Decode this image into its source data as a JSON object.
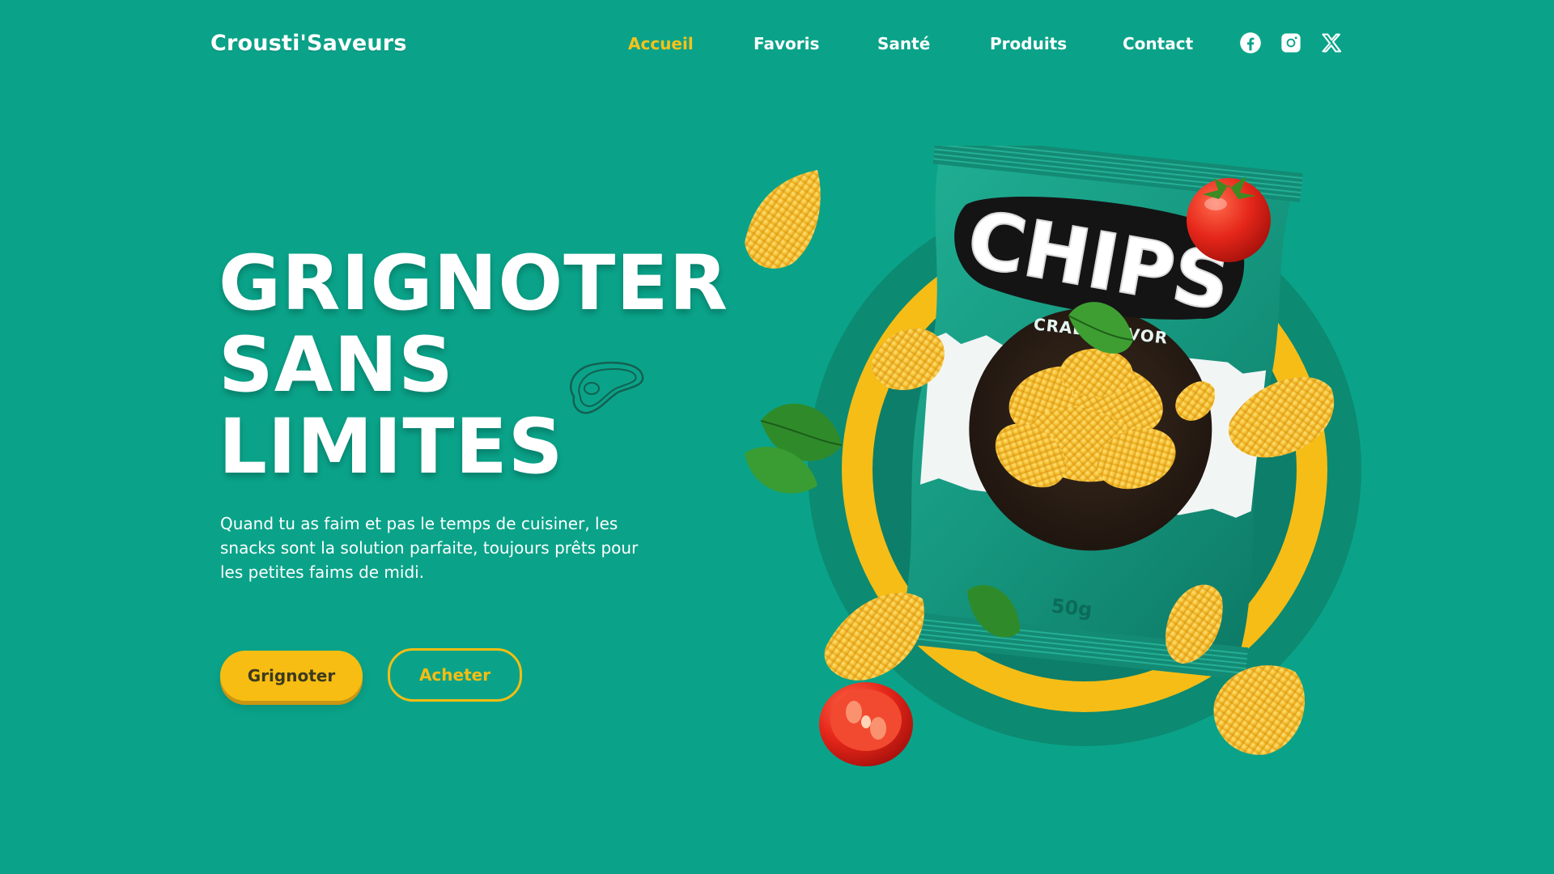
{
  "brand": {
    "logo_text": "Crousti'Saveurs"
  },
  "nav": {
    "items": [
      {
        "label": "Accueil",
        "active": true
      },
      {
        "label": "Favoris",
        "active": false
      },
      {
        "label": "Santé",
        "active": false
      },
      {
        "label": "Produits",
        "active": false
      },
      {
        "label": "Contact",
        "active": false
      }
    ]
  },
  "socials": [
    {
      "icon": "facebook-icon"
    },
    {
      "icon": "instagram-icon"
    },
    {
      "icon": "x-twitter-icon"
    }
  ],
  "hero": {
    "headline_lines": [
      "GRIGNOTER",
      "SANS",
      "LIMITES"
    ],
    "subtitle": "Quand tu as faim et pas le temps de cuisiner, les snacks sont la solution parfaite, toujours prêts pour les petites faims de midi.",
    "primary_button": "Grignoter",
    "secondary_button": "Acheter"
  },
  "product": {
    "brand_text": "CHIPS",
    "flavor_text": "CRAB FLAVOR",
    "weight_text": "50g"
  },
  "colors": {
    "background": "#0aa389",
    "accent": "#f7bd12",
    "active_nav": "#f6c21b",
    "bag_green": "#159a82",
    "circle_dark": "#0c7f6a"
  }
}
